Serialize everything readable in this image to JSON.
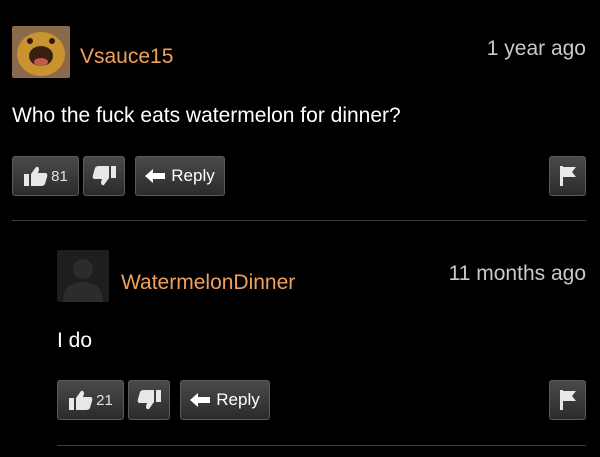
{
  "comments": [
    {
      "username": "Vsauce15",
      "timestamp": "1 year ago",
      "text": "Who the fuck eats watermelon for dinner?",
      "upvotes": "81",
      "reply_label": "Reply"
    },
    {
      "username": "WatermelonDinner",
      "timestamp": "11 months ago",
      "text": "I do",
      "upvotes": "21",
      "reply_label": "Reply"
    }
  ],
  "colors": {
    "background": "#000000",
    "username": "#f0a05a",
    "timestamp": "#c9c9c9",
    "button": "#3a3a3a"
  },
  "icons": [
    "avatar-photo",
    "default-avatar-icon",
    "thumbs-up-icon",
    "thumbs-down-icon",
    "reply-arrow-icon",
    "flag-icon"
  ]
}
